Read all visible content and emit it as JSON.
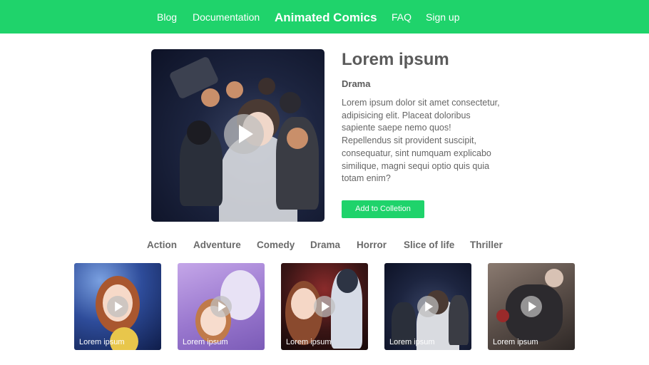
{
  "nav": {
    "links": [
      "Blog",
      "Documentation",
      "Animated Comics",
      "FAQ",
      "Sign up"
    ]
  },
  "hero": {
    "title": "Lorem ipsum",
    "genre": "Drama",
    "description": "Lorem ipsum dolor sit amet consectetur, adipisicing elit. Placeat doloribus sapiente saepe nemo quos! Repellendus sit provident suscipit, consequatur, sint numquam explicabo similique, magni sequi optio quis quia totam enim?",
    "button_label": "Add to Colletion"
  },
  "genres": [
    "Action",
    "Adventure",
    "Comedy",
    "Drama",
    "Horror",
    "Slice of life",
    "Thriller"
  ],
  "thumbnails": [
    {
      "label": "Lorem ipsum"
    },
    {
      "label": "Lorem ipsum"
    },
    {
      "label": "Lorem ipsum"
    },
    {
      "label": "Lorem ipsum"
    },
    {
      "label": "Lorem ipsum"
    }
  ],
  "colors": {
    "accent": "#1fd36b",
    "text": "#5f5f5f"
  },
  "icons": [
    "play-icon"
  ]
}
